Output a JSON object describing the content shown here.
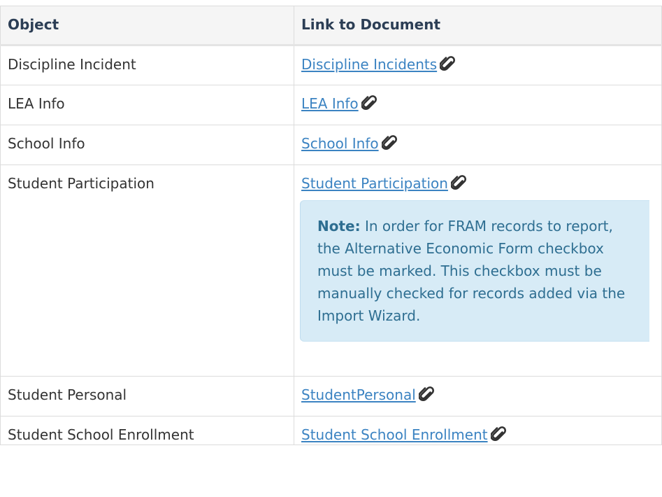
{
  "table": {
    "headers": [
      "Object",
      "Link to Document"
    ],
    "rows": [
      {
        "object": "Discipline Incident",
        "link": "Discipline Incidents"
      },
      {
        "object": "LEA Info",
        "link": "LEA Info"
      },
      {
        "object": "School Info",
        "link": "School Info"
      },
      {
        "object": "Student Participation",
        "link": "Student Participation",
        "note": {
          "label": "Note:",
          "text": "In order for FRAM records to report, the Alternative Economic Form checkbox must be marked. This checkbox must be manually checked for records added via the Import Wizard."
        }
      },
      {
        "object": "Student Personal",
        "link": "StudentPersonal"
      },
      {
        "object": "Student School Enrollment",
        "link": "Student School Enrollment"
      }
    ]
  },
  "icons": {
    "attachment": "paperclip-icon"
  },
  "colors": {
    "link": "#3b83c2",
    "note_bg": "#d7ebf6",
    "note_text": "#2e6e91",
    "header_text": "#2c3e55"
  }
}
